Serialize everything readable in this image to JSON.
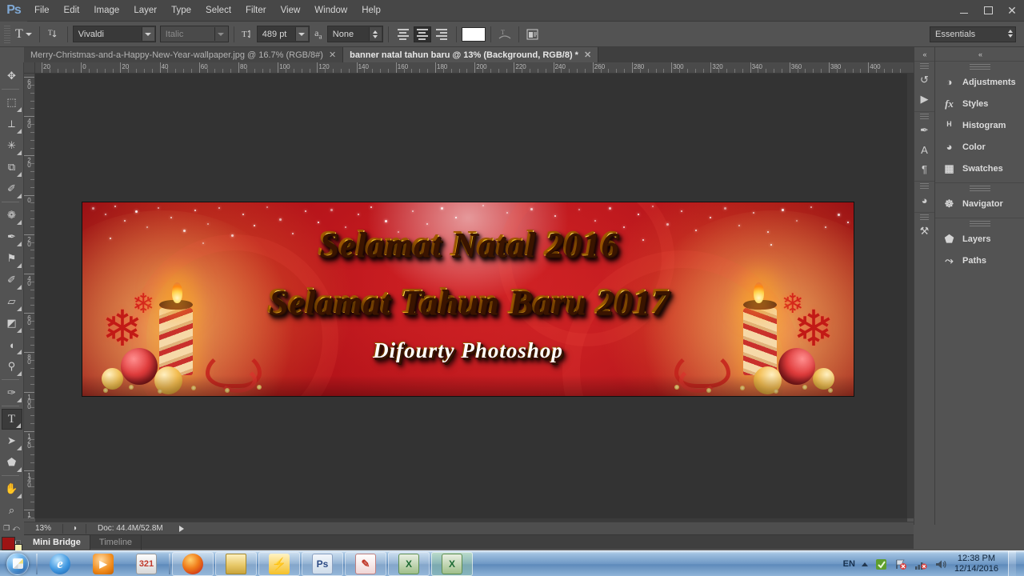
{
  "app": {
    "logo": "Ps",
    "workspace": "Essentials"
  },
  "menubar": {
    "items": [
      {
        "label": "File"
      },
      {
        "label": "Edit"
      },
      {
        "label": "Image"
      },
      {
        "label": "Layer"
      },
      {
        "label": "Type"
      },
      {
        "label": "Select"
      },
      {
        "label": "Filter"
      },
      {
        "label": "View"
      },
      {
        "label": "Window"
      },
      {
        "label": "Help"
      }
    ]
  },
  "window_controls": {
    "minimize": "minimize-icon",
    "restore": "restore-icon",
    "close": "✕"
  },
  "options_bar": {
    "tool": "type-tool",
    "orientation_icon": "text-orientation-icon",
    "font_family": "Vivaldi",
    "font_style": "Italic",
    "font_size": "489 pt",
    "antialias_icon": "aa-icon",
    "antialias_value": "None",
    "align": [
      "align-left",
      "align-center",
      "align-right"
    ],
    "align_selected": "align-center",
    "color_swatch": "#ffffff",
    "warp_icon": "warp-text-icon",
    "panels_icon": "character-paragraph-panels-icon"
  },
  "toolbar": {
    "tools": [
      {
        "name": "move-tool",
        "glyph": "✥",
        "active": false,
        "hasMenu": false
      },
      {
        "name": "rectangular-marquee-tool",
        "glyph": "⬚",
        "active": false,
        "hasMenu": true
      },
      {
        "name": "lasso-tool",
        "glyph": "⟂",
        "active": false,
        "hasMenu": true
      },
      {
        "name": "quick-selection-tool",
        "glyph": "✳",
        "active": false,
        "hasMenu": true
      },
      {
        "name": "crop-tool",
        "glyph": "⧉",
        "active": false,
        "hasMenu": true
      },
      {
        "name": "eyedropper-tool",
        "glyph": "✐",
        "active": false,
        "hasMenu": true
      },
      {
        "name": "spot-healing-brush-tool",
        "glyph": "❁",
        "active": false,
        "hasMenu": true
      },
      {
        "name": "brush-tool",
        "glyph": "✒",
        "active": false,
        "hasMenu": true
      },
      {
        "name": "clone-stamp-tool",
        "glyph": "⚑",
        "active": false,
        "hasMenu": true
      },
      {
        "name": "history-brush-tool",
        "glyph": "✐",
        "active": false,
        "hasMenu": true
      },
      {
        "name": "eraser-tool",
        "glyph": "▱",
        "active": false,
        "hasMenu": true
      },
      {
        "name": "gradient-tool",
        "glyph": "◩",
        "active": false,
        "hasMenu": true
      },
      {
        "name": "blur-tool",
        "glyph": "◖",
        "active": false,
        "hasMenu": true
      },
      {
        "name": "dodge-tool",
        "glyph": "⚲",
        "active": false,
        "hasMenu": true
      },
      {
        "name": "pen-tool",
        "glyph": "✑",
        "active": false,
        "hasMenu": true
      },
      {
        "name": "horizontal-type-tool",
        "glyph": "T",
        "active": true,
        "hasMenu": true
      },
      {
        "name": "path-selection-tool",
        "glyph": "➤",
        "active": false,
        "hasMenu": true
      },
      {
        "name": "custom-shape-tool",
        "glyph": "⬟",
        "active": false,
        "hasMenu": true
      },
      {
        "name": "hand-tool",
        "glyph": "✋",
        "active": false,
        "hasMenu": true
      },
      {
        "name": "zoom-tool",
        "glyph": "⌕",
        "active": false,
        "hasMenu": false
      }
    ],
    "foreground_color": "#9d1414",
    "background_color": "#f5efb0",
    "quick_mask_icon": "quick-mask-icon",
    "default_colors_icon": "default-colors-icon",
    "swap_colors_icon": "swap-colors-icon"
  },
  "document_tabs": [
    {
      "label": "Merry-Christmas-and-a-Happy-New-Year-wallpaper.jpg @ 16.7% (RGB/8#)",
      "active": false,
      "close": "✕"
    },
    {
      "label": "banner natal tahun baru @ 13% (Background, RGB/8) *",
      "active": true,
      "close": "✕"
    }
  ],
  "rulers": {
    "horizontal": [
      "20",
      "0",
      "20",
      "40",
      "60",
      "80",
      "100",
      "120",
      "140",
      "160",
      "180",
      "200",
      "220",
      "240",
      "260",
      "280",
      "300",
      "320",
      "340",
      "360",
      "380",
      "400"
    ],
    "vertical": [
      "60",
      "40",
      "20",
      "0",
      "20",
      "40",
      "60",
      "80",
      "100",
      "120",
      "140",
      "160"
    ],
    "unit": "cm"
  },
  "canvas": {
    "document_name": "banner natal tahun baru",
    "banner": {
      "line1": "Selamat Natal 2016",
      "line2": "Selamat Tahun Baru 2017",
      "line3": "Difourty  Photoshop",
      "background_color": "#b51019",
      "text_color": "#ffd21e",
      "signature_color": "#ffffff"
    }
  },
  "panel_icon_column": {
    "collapse_icon": "«",
    "groups": [
      {
        "icons": [
          {
            "name": "history-panel-icon",
            "glyph": "↺"
          },
          {
            "name": "actions-panel-icon",
            "glyph": "▶"
          }
        ]
      },
      {
        "icons": [
          {
            "name": "brush-presets-panel-icon",
            "glyph": "✒"
          },
          {
            "name": "character-panel-icon",
            "glyph": "A"
          },
          {
            "name": "paragraph-panel-icon",
            "glyph": "¶"
          }
        ]
      },
      {
        "icons": [
          {
            "name": "color-panel-icon",
            "glyph": "◕"
          }
        ]
      },
      {
        "icons": [
          {
            "name": "tool-presets-panel-icon",
            "glyph": "⚒"
          }
        ]
      }
    ]
  },
  "panels": {
    "collapse_icon": "«",
    "groups": [
      {
        "items": [
          {
            "label": "Adjustments",
            "icon": "adjustments-panel-icon",
            "glyph": "◑"
          },
          {
            "label": "Styles",
            "icon": "styles-panel-icon",
            "glyph": "fx"
          },
          {
            "label": "Histogram",
            "icon": "histogram-panel-icon",
            "glyph": "ᴴ"
          },
          {
            "label": "Color",
            "icon": "color-panel-icon",
            "glyph": "◕"
          },
          {
            "label": "Swatches",
            "icon": "swatches-panel-icon",
            "glyph": "▦"
          }
        ]
      },
      {
        "items": [
          {
            "label": "Navigator",
            "icon": "navigator-panel-icon",
            "glyph": "☸"
          }
        ]
      },
      {
        "items": [
          {
            "label": "Layers",
            "icon": "layers-panel-icon",
            "glyph": "⬟"
          },
          {
            "label": "Paths",
            "icon": "paths-panel-icon",
            "glyph": "⤳"
          }
        ]
      }
    ]
  },
  "status_bar": {
    "zoom": "13%",
    "mini_icon": "document-info-icon",
    "doc_info": "Doc: 44.4M/52.8M",
    "expand_arrow": "▶"
  },
  "bottom_tabs": [
    {
      "label": "Mini Bridge",
      "active": true
    },
    {
      "label": "Timeline",
      "active": false
    }
  ],
  "taskbar": {
    "start": "start-orb",
    "apps": [
      {
        "name": "internet-explorer",
        "glyph": "e",
        "cls": "ic-ie",
        "state": "pinned"
      },
      {
        "name": "windows-media-player",
        "glyph": "▶",
        "cls": "ic-wmp",
        "state": "pinned"
      },
      {
        "name": "media-player-classic-321",
        "glyph": "321",
        "cls": "ic-klite",
        "state": "pinned"
      },
      {
        "name": "mozilla-firefox",
        "glyph": "",
        "cls": "ic-ff",
        "state": "running"
      },
      {
        "name": "windows-explorer",
        "glyph": "",
        "cls": "ic-exp",
        "state": "running"
      },
      {
        "name": "winamp",
        "glyph": "⚡",
        "cls": "ic-bolt",
        "state": "running"
      },
      {
        "name": "adobe-photoshop",
        "glyph": "Ps",
        "cls": "ic-ps",
        "state": "active"
      },
      {
        "name": "microsoft-powerpoint",
        "glyph": "✎",
        "cls": "ic-ppt",
        "state": "running"
      },
      {
        "name": "microsoft-excel",
        "glyph": "X",
        "cls": "ic-xls",
        "state": "running"
      },
      {
        "name": "microsoft-excel-2",
        "glyph": "X",
        "cls": "ic-xls",
        "state": "active2"
      }
    ],
    "tray": {
      "language": "EN",
      "show_hidden_icons": "chevron-up-icon",
      "icons": [
        {
          "name": "antivirus-tray-icon",
          "glyph": "◢"
        },
        {
          "name": "network-tray-icon",
          "glyph": "⚑"
        },
        {
          "name": "signal-tray-icon",
          "glyph": "▂"
        },
        {
          "name": "volume-tray-icon",
          "glyph": "🔊"
        }
      ],
      "time": "12:38 PM",
      "date": "12/14/2016"
    }
  }
}
